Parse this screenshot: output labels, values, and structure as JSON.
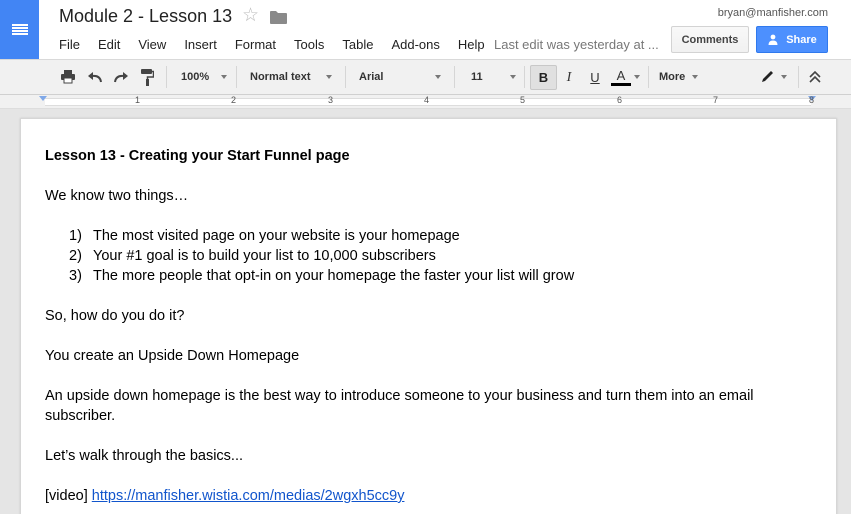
{
  "app": {
    "logo_icon": "docs-logo-icon",
    "accent_color": "#4285f4"
  },
  "document": {
    "title": "Module 2 - Lesson 13",
    "star_icon": "star-icon",
    "folder_icon": "folder-icon"
  },
  "user": {
    "email": "bryan@manfisher.com"
  },
  "menu": {
    "items": [
      "File",
      "Edit",
      "View",
      "Insert",
      "Format",
      "Tools",
      "Table",
      "Add-ons",
      "Help"
    ],
    "last_edit": "Last edit was yesterday at ..."
  },
  "buttons": {
    "comments": "Comments",
    "share": "Share",
    "share_color": "#4d90fe"
  },
  "toolbar": {
    "zoom": "100%",
    "style": "Normal text",
    "font": "Arial",
    "size": "11",
    "bold": "B",
    "italic": "I",
    "underline": "U",
    "text_color": "A",
    "more": "More",
    "icons": [
      "print-icon",
      "undo-icon",
      "redo-icon",
      "paint-format-icon",
      "pen-icon",
      "collapse-icon"
    ]
  },
  "ruler": {
    "numbers": [
      "1",
      "2",
      "3",
      "4",
      "5",
      "6",
      "7",
      "8"
    ]
  },
  "content": {
    "heading": "Lesson 13 - Creating your Start Funnel page",
    "intro": "We know two things…",
    "list": [
      {
        "num": "1)",
        "text": "The most visited page on your website is your homepage"
      },
      {
        "num": "2)",
        "text": "Your #1 goal is to build your list to 10,000 subscribers"
      },
      {
        "num": "3)",
        "text": "The more people that opt-in on your homepage the faster your list will grow"
      }
    ],
    "question": "So, how do you do it?",
    "answer": "You create an Upside Down Homepage",
    "explanation": "An upside down homepage is the best way to introduce someone to your business and turn them into an email subscriber.",
    "walkthrough": "Let’s walk through the basics...",
    "video_prefix": "[video]",
    "video_link": "https://manfisher.wistia.com/medias/2wgxh5cc9y"
  }
}
